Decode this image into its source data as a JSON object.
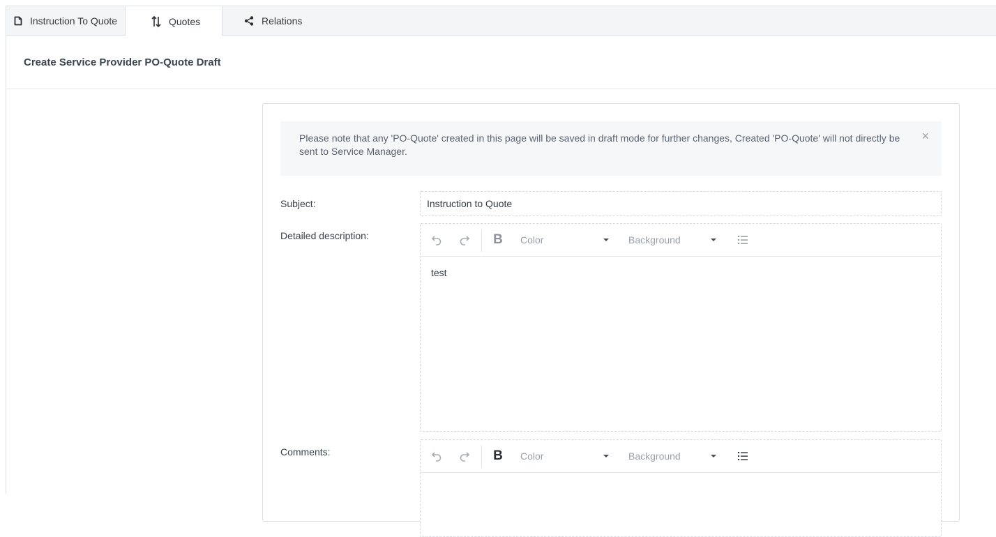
{
  "tabs": [
    {
      "label": "Instruction To Quote",
      "icon": "document-icon",
      "active": false
    },
    {
      "label": "Quotes",
      "icon": "sort-arrows-icon",
      "active": true
    },
    {
      "label": "Relations",
      "icon": "share-icon",
      "active": false
    }
  ],
  "page": {
    "title": "Create Service Provider PO-Quote Draft"
  },
  "notice": {
    "text": "Please note that any 'PO-Quote' created in this page will be saved in draft mode for further changes, Created 'PO-Quote' will not directly be sent to Service Manager.",
    "close_symbol": "×"
  },
  "form": {
    "subject_label": "Subject:",
    "subject_value": "Instruction to Quote",
    "description_label": "Detailed description:",
    "description_value": "test",
    "comments_label": "Comments:",
    "comments_value": ""
  },
  "toolbar": {
    "bold_label": "B",
    "color_label": "Color",
    "background_label": "Background"
  },
  "colors": {
    "tab_bg": "#f4f5f7",
    "border": "#dcdfe4",
    "notice_bg": "#f6f7f9",
    "text": "#333a44"
  }
}
